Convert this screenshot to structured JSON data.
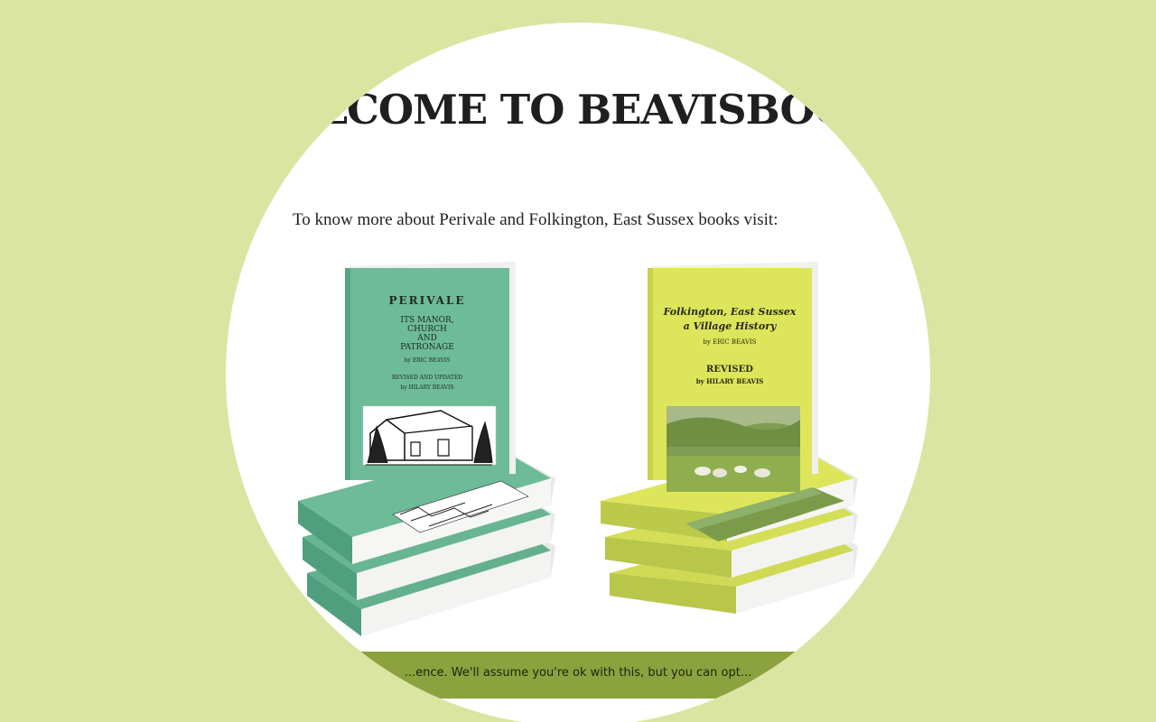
{
  "page": {
    "title": "WELCOME TO BEAVISBOOKS",
    "intro": "To know more about Perivale and Folkington, East Sussex books visit:"
  },
  "books": [
    {
      "cover_title": "PERIVALE",
      "cover_subtitle_1": "ITS MANOR,",
      "cover_subtitle_2": "CHURCH",
      "cover_subtitle_3": "AND",
      "cover_subtitle_4": "PATRONAGE",
      "author": "by ERIC BEAVIS",
      "revised": "REVISED AND UPDATED",
      "reviser": "by HILARY BEAVIS",
      "cover_color": "#6dbb98"
    },
    {
      "cover_title": "Folkington, East Sussex",
      "cover_subtitle_1": "a Village History",
      "author": "by ERIC BEAVIS",
      "revised": "REVISED",
      "reviser": "by HILARY BEAVIS",
      "cover_color": "#dde65a"
    }
  ],
  "cookie_notice": {
    "text": "...ence. We'll assume you're ok with this, but you can opt..."
  },
  "colors": {
    "background": "#dae5a2",
    "cookie_bar": "#8ba23e",
    "heading": "#1f1f1f"
  }
}
